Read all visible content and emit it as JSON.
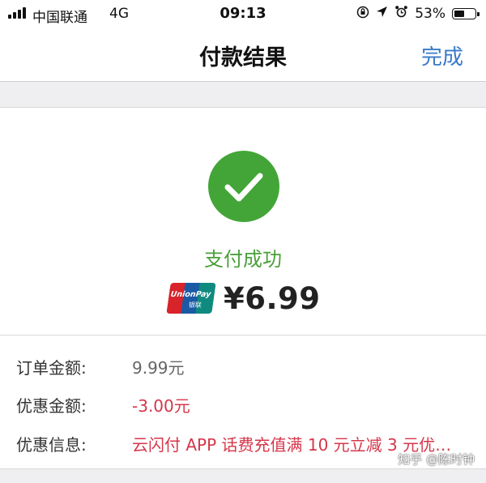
{
  "status_bar": {
    "carrier": "中国联通",
    "network": "4G",
    "time": "09:13",
    "battery_percent": "53%",
    "battery_level": 0.53,
    "icons": [
      "signal-icon",
      "orientation-lock-icon",
      "location-arrow-icon",
      "alarm-icon",
      "battery-icon"
    ]
  },
  "nav": {
    "title": "付款结果",
    "done_label": "完成"
  },
  "result": {
    "status_text": "支付成功",
    "amount": "¥6.99",
    "payment_logo": {
      "name": "unionpay-logo",
      "text": "UnionPay",
      "text_cn": "银联"
    },
    "success_color": "#43a538"
  },
  "details": [
    {
      "label": "订单金额:",
      "value": "9.99元",
      "value_color": "#666666"
    },
    {
      "label": "优惠金额:",
      "value": "-3.00元",
      "value_color": "#d6364a"
    },
    {
      "label": "优惠信息:",
      "value": "云闪付 APP 话费充值满 10 元立减 3 元优…",
      "value_color": "#d6364a"
    }
  ],
  "watermark": "知乎 @陈时钟",
  "colors": {
    "accent_blue": "#3a7ac9",
    "promo_red": "#d6364a",
    "background_gray": "#efeff2"
  }
}
